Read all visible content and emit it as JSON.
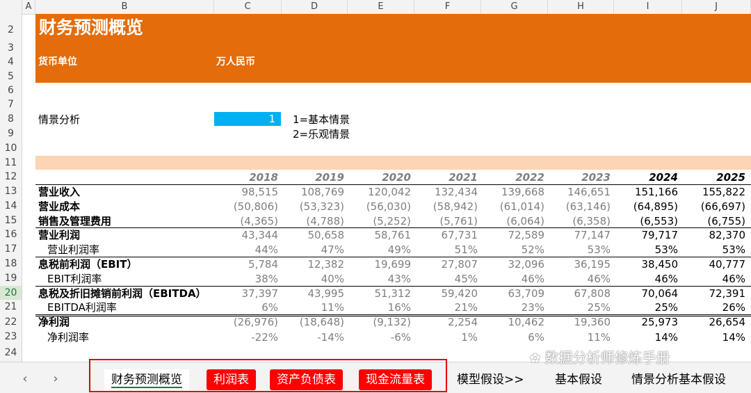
{
  "columns": [
    "A",
    "B",
    "C",
    "D",
    "E",
    "F",
    "G",
    "H",
    "I",
    "J"
  ],
  "rows": [
    "2",
    "3",
    "4",
    "5",
    "6",
    "7",
    "8",
    "9",
    "10",
    "11",
    "12",
    "13",
    "14",
    "15",
    "16",
    "17",
    "18",
    "19",
    "20",
    "21",
    "22",
    "23",
    "24"
  ],
  "header": {
    "title": "财务预测概览",
    "currency_label": "货币单位",
    "currency_value": "万人民币",
    "accent_color": "#e46c0a"
  },
  "scenario": {
    "label": "情景分析",
    "value": "1",
    "option1": "1=基本情景",
    "option2": "2=乐观情景"
  },
  "years": [
    "2018",
    "2019",
    "2020",
    "2021",
    "2022",
    "2023",
    "2024",
    "2025"
  ],
  "table": [
    {
      "label": "营业收入",
      "bold": true,
      "values": [
        "98,515",
        "108,769",
        "120,042",
        "132,434",
        "139,668",
        "146,651",
        "151,166",
        "155,822"
      ]
    },
    {
      "label": "营业成本",
      "bold": true,
      "values": [
        "(50,806)",
        "(53,323)",
        "(56,030)",
        "(58,942)",
        "(61,014)",
        "(63,146)",
        "(64,895)",
        "(66,697)"
      ]
    },
    {
      "label": "销售及管理费用",
      "bold": true,
      "values": [
        "(4,365)",
        "(4,788)",
        "(5,252)",
        "(5,761)",
        "(6,064)",
        "(6,358)",
        "(6,553)",
        "(6,755)"
      ]
    },
    {
      "label": "营业利润",
      "bold": true,
      "values": [
        "43,344",
        "50,658",
        "58,761",
        "67,731",
        "72,589",
        "77,147",
        "79,717",
        "82,370"
      ]
    },
    {
      "label": "营业利润率",
      "bold": false,
      "values": [
        "44%",
        "47%",
        "49%",
        "51%",
        "52%",
        "53%",
        "53%",
        "53%"
      ]
    },
    {
      "label": "息税前利润（EBIT）",
      "bold": true,
      "values": [
        "5,784",
        "12,382",
        "19,699",
        "27,807",
        "32,096",
        "36,195",
        "38,450",
        "40,777"
      ]
    },
    {
      "label": "EBIT利润率",
      "bold": false,
      "values": [
        "38%",
        "40%",
        "43%",
        "45%",
        "46%",
        "46%",
        "46%",
        "46%"
      ]
    },
    {
      "label": "息税及折旧摊销前利润（EBITDA）",
      "bold": true,
      "values": [
        "37,397",
        "43,995",
        "51,312",
        "59,420",
        "63,709",
        "67,808",
        "70,064",
        "72,391"
      ]
    },
    {
      "label": "EBITDA利润率",
      "bold": false,
      "values": [
        "6%",
        "11%",
        "16%",
        "21%",
        "23%",
        "25%",
        "25%",
        "26%"
      ]
    },
    {
      "label": "净利润",
      "bold": true,
      "values": [
        "(26,976)",
        "(18,648)",
        "(9,132)",
        "2,254",
        "10,462",
        "19,360",
        "25,973",
        "26,654"
      ]
    },
    {
      "label": "净利润率",
      "bold": false,
      "values": [
        "-22%",
        "-14%",
        "-6%",
        "1%",
        "6%",
        "11%",
        "14%",
        "14%"
      ]
    }
  ],
  "tabs": {
    "nav_prev": "‹",
    "nav_next": "›",
    "items": [
      "财务预测概览",
      "利润表",
      "资产负债表",
      "现金流量表",
      "模型假设>>",
      "基本假设",
      "情景分析基本假设"
    ]
  },
  "watermark": "数据分析师修炼手册"
}
